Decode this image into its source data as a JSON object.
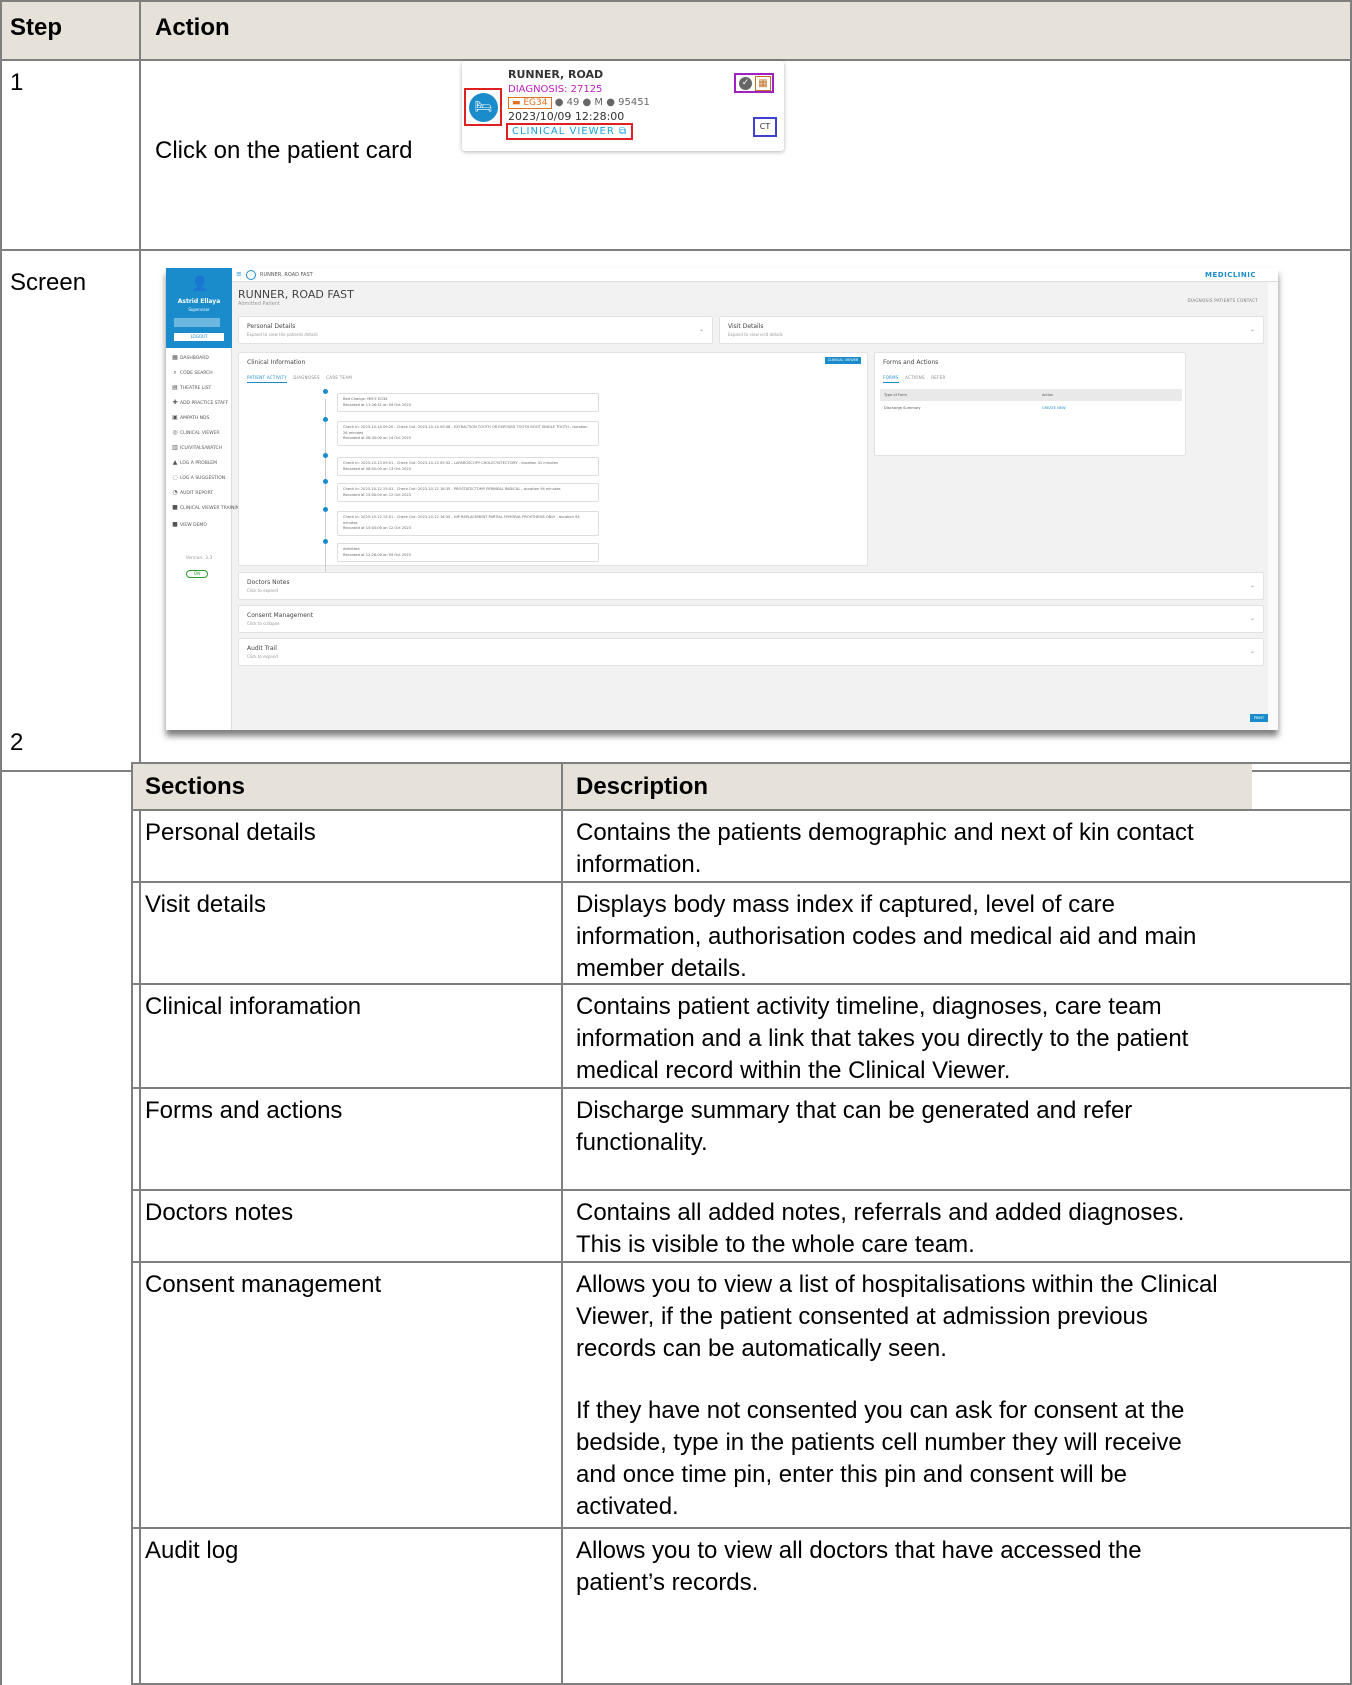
{
  "table": {
    "header_step": "Step",
    "header_action": "Action",
    "row1_step": "1",
    "row1_action": "Click on the patient card",
    "row2_step": "Screen",
    "row3_step": "2"
  },
  "patient_card": {
    "name": "RUNNER, ROAD",
    "diagnosis": "DIAGNOSIS: 27125",
    "ward": "EG34",
    "meta": "● 49 ● M ● 95451",
    "datetime": "2023/10/09 12:28:00",
    "link": "CLINICAL VIEWER",
    "ct": "CT",
    "icons": [
      "bed-icon",
      "check-circle-icon",
      "bed-grid-icon",
      "external-link-icon"
    ]
  },
  "screen": {
    "user_name": "Astrid Ellaya",
    "user_role": "Supervisor",
    "logout": "LOGOUT",
    "topbar_name": "RUNNER, ROAD FAST",
    "brand": "MEDICLINIC",
    "patient_title": "RUNNER, ROAD FAST",
    "patient_status": "Admitted Patient",
    "top_links": "DIAGNOSIS   PATIENTS   CONTACT",
    "sidebar": [
      {
        "icon": "▦",
        "label": "DASHBOARD"
      },
      {
        "icon": "⌕",
        "label": "CODE SEARCH"
      },
      {
        "icon": "▤",
        "label": "THEATRE LIST"
      },
      {
        "icon": "✚",
        "label": "ADD PRACTICE STAFF"
      },
      {
        "icon": "▣",
        "label": "AMPATH NDS"
      },
      {
        "icon": "◎",
        "label": "CLINICAL VIEWER"
      },
      {
        "icon": "▥",
        "label": "ICU/VITALS/WATCH"
      },
      {
        "icon": "▲",
        "label": "LOG A PROBLEM"
      },
      {
        "icon": "◌",
        "label": "LOG A SUGGESTION"
      },
      {
        "icon": "◔",
        "label": "AUDIT REPORT"
      },
      {
        "icon": "■",
        "label": "CLINICAL VIEWER TRAINING"
      },
      {
        "icon": "■",
        "label": "VIEW DEMO"
      }
    ],
    "version": "Version: 3.3",
    "toggle": "ON",
    "personal_details": {
      "title": "Personal Details",
      "sub": "Expand to view the patients details"
    },
    "visit_details": {
      "title": "Visit Details",
      "sub": "Expand to view visit details"
    },
    "clinical_information": {
      "title": "Clinical Information",
      "button": "CLINICAL VIEWER",
      "tabs": [
        "PATIENT ACTIVITY",
        "DIAGNOSES",
        "CARE TEAM"
      ],
      "timeline": [
        {
          "line1": "Bed Change: MM E EG34",
          "line2": "Recorded at 11:26:41 on 09 Oct 2023"
        },
        {
          "line1": "Check In: 2023-10-14 09:20 - Check Out: 2023-10-14 09:46 - EXTRACTION TOOTH OR EXPOSED TOOTH ROOT SINGLE TOOTH - duration 26 minutes",
          "line2": "Recorded at 08:30:00 on 14 Oct 2023"
        },
        {
          "line1": "Check In: 2023-10-13 09:01 - Check Out: 2023-10-13 09:32 - LAPAROSCOPY CHOLECYSTECTOMY - duration 31 minutes",
          "line2": "Recorded at 08:00:00 on 13 Oct 2023"
        },
        {
          "line1": "Check In: 2023-10-12 15:01 - Check Out: 2023-10-12 16:35 - PROSTATECTOMY PERINEAL RADICAL - duration 94 minutes",
          "line2": "Recorded at 15:00:00 on 12 Oct 2023"
        },
        {
          "line1": "Check In: 2023-10-12 15:01 - Check Out: 2023-10-12 16:35 - HIP REPLACEMENT PARTIAL FEMORAL PROSTHESIS ONLY - duration 94 minutes",
          "line2": "Recorded at 15:00:00 on 12 Oct 2023"
        },
        {
          "line1": "Admitted",
          "line2": "Recorded at 12:28:00 on 09 Oct 2023"
        }
      ]
    },
    "forms_actions": {
      "title": "Forms and Actions",
      "tabs": [
        "FORMS",
        "ACTIONS",
        "REFER"
      ],
      "col1": "Type of Form",
      "col2": "Action",
      "row_name": "Discharge Summary",
      "row_action": "CREATE NEW"
    },
    "doctors_notes": {
      "title": "Doctors Notes",
      "sub": "Click to expand"
    },
    "consent_management": {
      "title": "Consent Management",
      "sub": "Click to collapse"
    },
    "audit_trail": {
      "title": "Audit Trail",
      "sub": "Click to expand"
    },
    "print": "PRINT"
  },
  "sections_table": {
    "header_sections": "Sections",
    "header_description": "Description",
    "rows": [
      {
        "section": "Personal details",
        "description": [
          "Contains the patients demographic and next of kin contact",
          "information."
        ]
      },
      {
        "section": "Visit details",
        "description": [
          "Displays body mass index if captured, level of care",
          "information, authorisation codes and medical aid and main",
          "member details."
        ]
      },
      {
        "section": "Clinical inforamation",
        "description": [
          "Contains patient activity timeline, diagnoses, care team",
          "information and a link that takes you directly to the patient",
          "medical record within the Clinical Viewer."
        ]
      },
      {
        "section": "Forms and actions",
        "description": [
          "Discharge summary that can be generated and refer",
          "functionality."
        ]
      },
      {
        "section": "Doctors notes",
        "description": [
          "Contains all added notes, referrals and added diagnoses.",
          "This is visible to the whole care team."
        ]
      },
      {
        "section": "Consent management",
        "description": [
          "Allows you to view a list of hospitalisations within the Clinical",
          "Viewer, if the patient consented at admission previous",
          "records can be automatically seen."
        ],
        "description2": [
          "If they have not consented you can ask for consent at the",
          "bedside, type in the patients cell number they will receive",
          "and once time pin, enter this pin and consent will be",
          "activated."
        ]
      },
      {
        "section": "Audit log",
        "description": [
          "Allows you to view all doctors that have accessed the",
          "patient’s records."
        ]
      }
    ]
  }
}
